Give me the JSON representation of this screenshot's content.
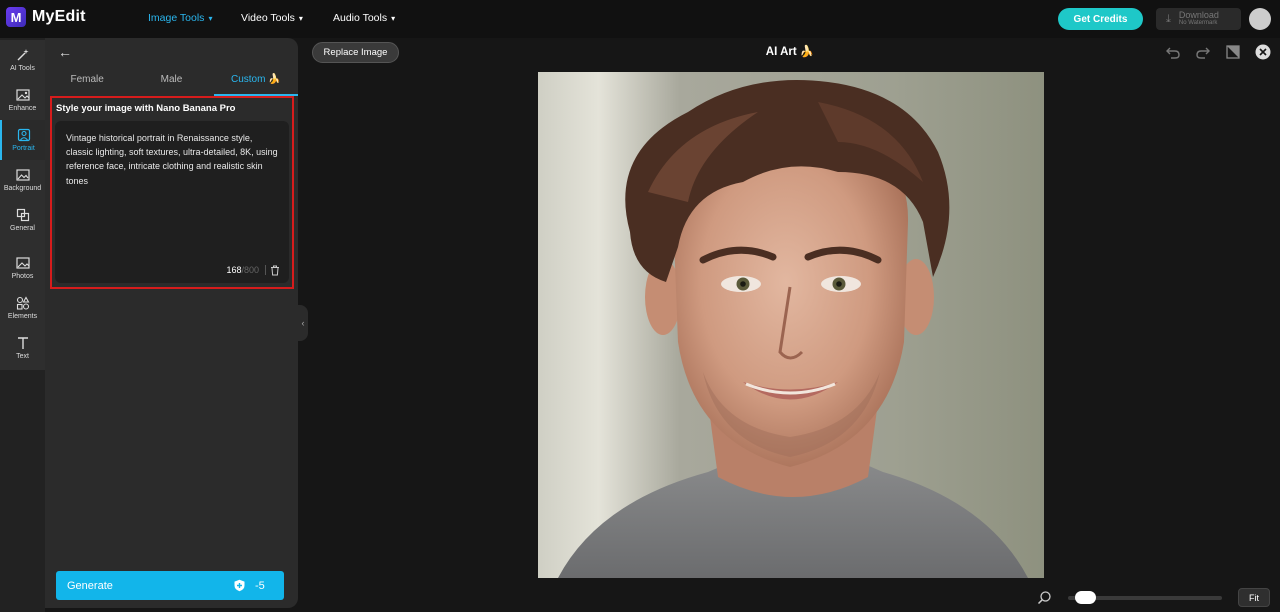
{
  "app": {
    "logo_letter": "M",
    "name": "MyEdit"
  },
  "nav": {
    "image_tools": "Image Tools",
    "video_tools": "Video Tools",
    "audio_tools": "Audio Tools"
  },
  "header": {
    "get_credits": "Get Credits",
    "download": "Download",
    "download_sub": "No Watermark"
  },
  "rail": {
    "ai_tools": "AI Tools",
    "enhance": "Enhance",
    "portrait": "Portrait",
    "background": "Background",
    "general": "General",
    "photos": "Photos",
    "elements": "Elements",
    "text": "Text"
  },
  "panel": {
    "tabs": [
      "Female",
      "Male",
      "Custom 🍌"
    ],
    "prompt_title": "Style your image with Nano Banana Pro",
    "prompt_text": "Vintage historical portrait in Renaissance style, classic lighting, soft textures, ultra-detailed, 8K, using reference face, intricate clothing and realistic skin tones",
    "char_count": "168",
    "char_max": "/800",
    "generate_label": "Generate",
    "generate_cost": "-5"
  },
  "canvas": {
    "replace_image": "Replace Image",
    "title": "AI Art 🍌",
    "fit": "Fit",
    "zoom_level": 0.05
  },
  "colors": {
    "accent": "#2ab6ee",
    "credits": "#1ec8c8",
    "generate": "#12b5ea",
    "highlight": "#d61c1c"
  }
}
